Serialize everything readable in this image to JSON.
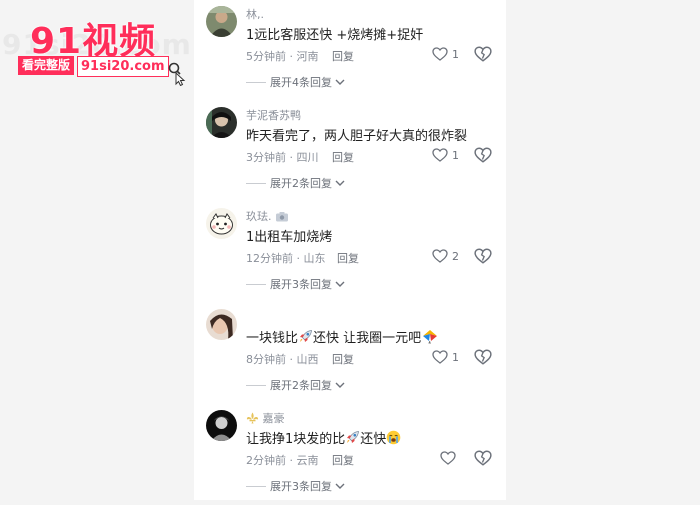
{
  "watermark": {
    "title": "91视频",
    "bg_text": "91si20.com",
    "badge": "看完整版",
    "url": "91si20.com"
  },
  "colors": {
    "brand": "#ff2e5a",
    "meta": "#8a8f99",
    "text": "#1f1f1f"
  },
  "comments": [
    {
      "username": "林,.",
      "text": "1远比客服还快 +烧烤摊+捉奸",
      "time_location": "5分钟前 · 河南",
      "reply_label": "回复",
      "likes": "1",
      "expand_label": "展开4条回复",
      "avatar_icon": "avatar-photo"
    },
    {
      "username": "芋泥香苏鸭",
      "text": "昨天看完了，两人胆子好大真的很炸裂",
      "time_location": "3分钟前 · 四川",
      "reply_label": "回复",
      "likes": "1",
      "expand_label": "展开2条回复",
      "avatar_icon": "avatar-photo"
    },
    {
      "username": "玖珐.",
      "text": "1出租车加烧烤",
      "time_location": "12分钟前 · 山东",
      "reply_label": "回复",
      "likes": "2",
      "expand_label": "展开3条回复",
      "avatar_icon": "avatar-cartoon"
    },
    {
      "username": "",
      "text_before_icon": "一块钱比",
      "text_after_icon": "还快 让我圈一元吧",
      "time_location": "8分钟前 · 山西",
      "reply_label": "回复",
      "likes": "1",
      "expand_label": "展开2条回复",
      "avatar_icon": "avatar-photo"
    },
    {
      "username": "嘉豪",
      "text_before_icon": "让我挣1块发的比",
      "text_after_icon": "还快",
      "time_location": "2分钟前 · 云南",
      "reply_label": "回复",
      "likes": "",
      "expand_label": "展开3条回复",
      "avatar_icon": "avatar-photo"
    }
  ]
}
